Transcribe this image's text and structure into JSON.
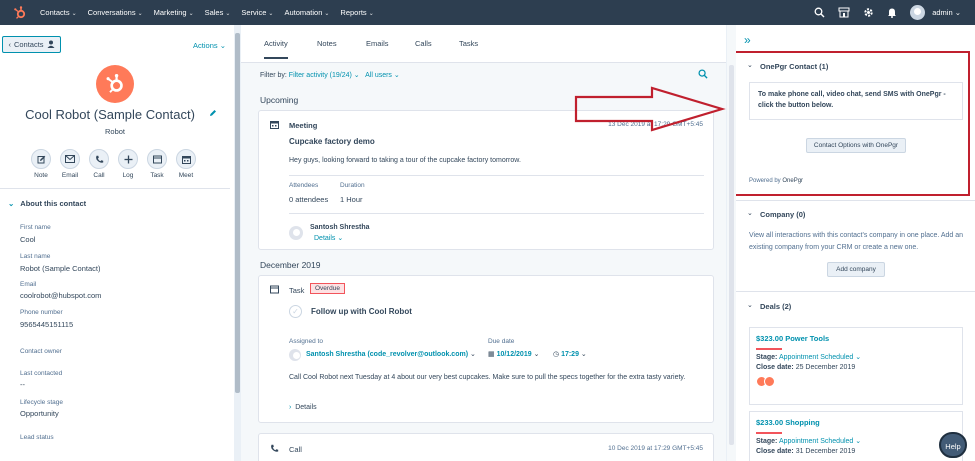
{
  "nav": {
    "items": [
      "Contacts",
      "Conversations",
      "Marketing",
      "Sales",
      "Service",
      "Automation",
      "Reports"
    ],
    "user": "admin"
  },
  "contact": {
    "back_label": "Contacts",
    "actions_label": "Actions",
    "name": "Cool Robot (Sample Contact)",
    "company": "Robot",
    "quick_actions": [
      "Note",
      "Email",
      "Call",
      "Log",
      "Task",
      "Meet"
    ],
    "about_title": "About this contact",
    "props": [
      {
        "label": "First name",
        "value": "Cool"
      },
      {
        "label": "Last name",
        "value": "Robot (Sample Contact)"
      },
      {
        "label": "Email",
        "value": "coolrobot@hubspot.com"
      },
      {
        "label": "Phone number",
        "value": "9565445151115"
      },
      {
        "label": "Contact owner",
        "value": ""
      },
      {
        "label": "Last contacted",
        "value": "--"
      },
      {
        "label": "Lifecycle stage",
        "value": "Opportunity"
      },
      {
        "label": "Lead status",
        "value": ""
      }
    ]
  },
  "activity": {
    "tabs": [
      "Activity",
      "Notes",
      "Emails",
      "Calls",
      "Tasks"
    ],
    "filter_prefix": "Filter by:",
    "filter_activity": "Filter activity (19/24)",
    "filter_users": "All users",
    "upcoming_label": "Upcoming",
    "meeting": {
      "type": "Meeting",
      "date": "13 Dec 2019 at 17:29 GMT+5:45",
      "title": "Cupcake factory demo",
      "body": "Hey guys, looking forward to taking a tour of the cupcake factory tomorrow.",
      "attendees_label": "Attendees",
      "attendees_value": "0 attendees",
      "duration_label": "Duration",
      "duration_value": "1 Hour",
      "organizer": "Santosh Shrestha",
      "details": "Details"
    },
    "month_label": "December 2019",
    "task": {
      "type": "Task",
      "badge": "Overdue",
      "title": "Follow up with Cool Robot",
      "assigned_label": "Assigned to",
      "assigned_value": "Santosh Shrestha (code_revolver@outlook.com)",
      "due_label": "Due date",
      "due_date": "10/12/2019",
      "due_time": "17:29",
      "body": "Call Cool Robot next Tuesday at 4 about our very best cupcakes. Make sure to pull the specs together for the extra tasty variety.",
      "details": "Details"
    },
    "call": {
      "type": "Call",
      "date": "10 Dec 2019 at 17:29 GMT+5:45"
    }
  },
  "sidebar_right": {
    "onepgr": {
      "title": "OnePgr Contact (1)",
      "description": "To make phone call, video chat, send SMS with OnePgr - click the button below.",
      "button": "Contact Options with OnePgr",
      "powered_prefix": "Powered by",
      "powered_brand": "OnePgr"
    },
    "company": {
      "title": "Company (0)",
      "description": "View all interactions with this contact's company in one place. Add an existing company from your CRM or create a new one.",
      "button": "Add company"
    },
    "deals": {
      "title": "Deals (2)",
      "items": [
        {
          "name": "$323.00 Power Tools",
          "stage_label": "Stage:",
          "stage": "Appointment Scheduled",
          "close_label": "Close date:",
          "close": "25 December 2019"
        },
        {
          "name": "$233.00 Shopping",
          "stage_label": "Stage:",
          "stage": "Appointment Scheduled",
          "close_label": "Close date:",
          "close": "31 December 2019"
        }
      ]
    },
    "help": "Help"
  },
  "colors": {
    "nav_bg": "#2d3e50",
    "accent": "#0091ae",
    "brand_orange": "#ff7a59",
    "highlight_red": "#c0202e"
  }
}
